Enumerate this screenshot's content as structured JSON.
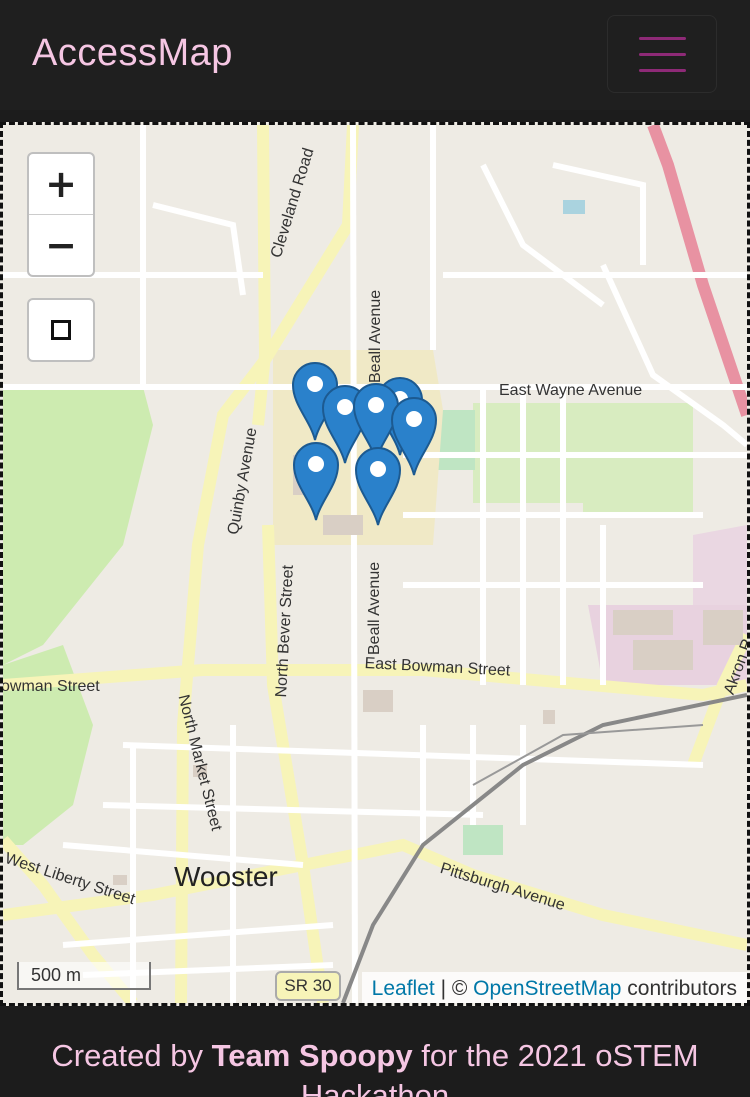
{
  "navbar": {
    "brand": "AccessMap"
  },
  "map": {
    "zoom_in_label": "+",
    "zoom_out_label": "−",
    "scale_label": "500 m",
    "route_shield": "SR 30",
    "attribution": {
      "leaflet": "Leaflet",
      "separator": " | © ",
      "osm": "OpenStreetMap",
      "suffix": " contributors"
    },
    "labels": {
      "cleveland_road": "Cleveland Road",
      "beall_avenue_north": "Beall Avenue",
      "east_wayne_avenue": "East Wayne Avenue",
      "quinby_avenue": "Quinby Avenue",
      "north_bever_street": "North Bever Street",
      "beall_avenue_south": "Beall Avenue",
      "east_bowman_street": "East Bowman Street",
      "bowman_street_west": "owman Street",
      "akron_road": "Akron R",
      "north_market_street": "North Market Street",
      "wooster": "Wooster",
      "west_liberty_street": "West Liberty Street",
      "pittsburgh_avenue": "Pittsburgh Avenue"
    },
    "marker_count": 7
  },
  "footer": {
    "prefix": "Created by ",
    "team": "Team Spoopy",
    "suffix": " for the 2021 oSTEM",
    "line2": "Hackathon"
  }
}
